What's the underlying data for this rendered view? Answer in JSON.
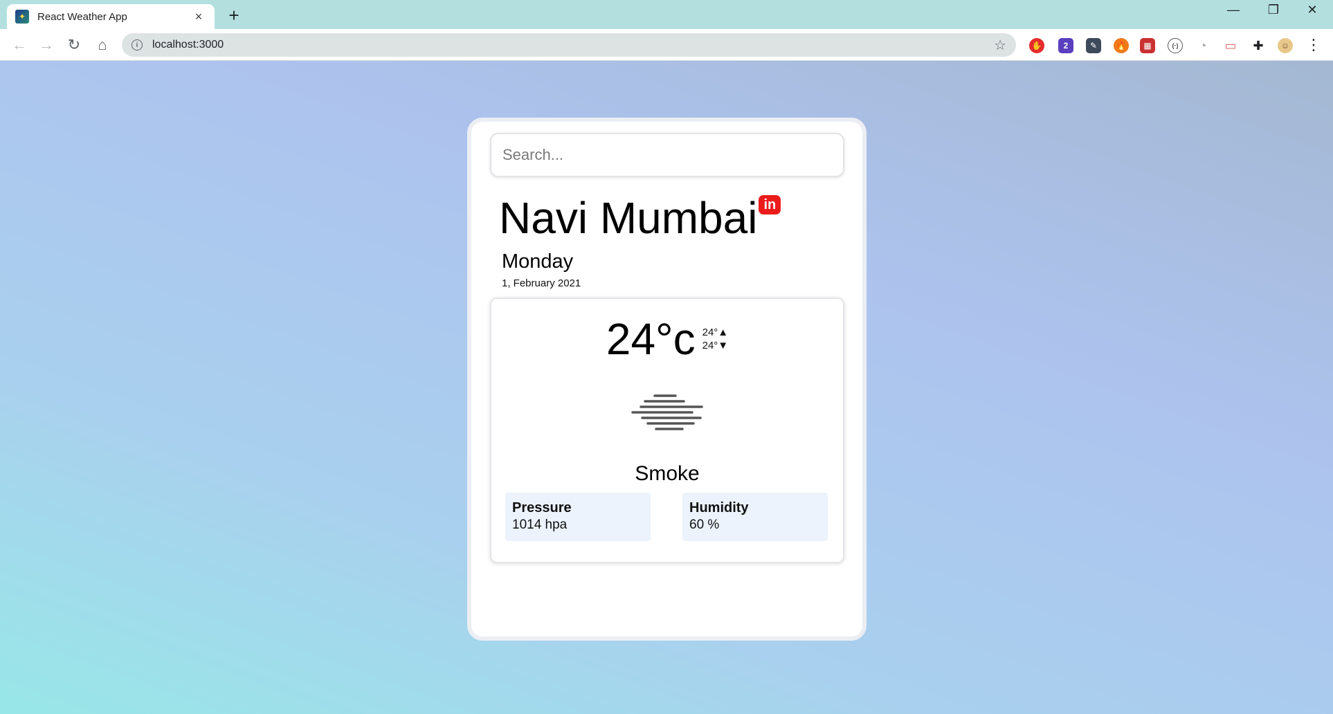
{
  "browser": {
    "tab_title": "React Weather App",
    "tab_close": "×",
    "new_tab": "+",
    "url": "localhost:3000",
    "window": {
      "minimize": "—",
      "restore": "❐",
      "close": "✕"
    },
    "nav": {
      "back": "←",
      "forward": "→",
      "reload": "↻",
      "home": "⌂"
    },
    "star": "☆",
    "extensions": [
      {
        "name": "adblock-extension-icon",
        "color": "#e52b2b",
        "glyph": "✋"
      },
      {
        "name": "graduation-extension-icon",
        "color": "#5a3fc0",
        "glyph": "2"
      },
      {
        "name": "eyedropper-extension-icon",
        "color": "#3d4a5c",
        "glyph": "✎"
      },
      {
        "name": "fire-extension-icon",
        "color": "#f07a1a",
        "glyph": "🔥"
      },
      {
        "name": "grid-extension-icon",
        "color": "#c93030",
        "glyph": "▦"
      },
      {
        "name": "code-extension-icon",
        "color": "#ffffff",
        "glyph": "(·)"
      },
      {
        "name": "dial-extension-icon",
        "color": "#ffffff",
        "glyph": "◔"
      },
      {
        "name": "calendar-extension-icon",
        "color": "#ffffff",
        "glyph": "▭"
      },
      {
        "name": "puzzle-extensions-icon",
        "color": "#ffffff",
        "glyph": "✚"
      }
    ],
    "menu": "⋮"
  },
  "weather": {
    "search_placeholder": "Search...",
    "city": "Navi Mumbai",
    "country_code": "in",
    "day": "Monday",
    "date": "1, February 2021",
    "temp": "24°c",
    "temp_max": "24°▲",
    "temp_min": "24°▼",
    "icon": "smoke-icon",
    "description": "Smoke",
    "pressure": {
      "label": "Pressure",
      "value": "1014 hpa"
    },
    "humidity": {
      "label": "Humidity",
      "value": "60 %"
    }
  }
}
